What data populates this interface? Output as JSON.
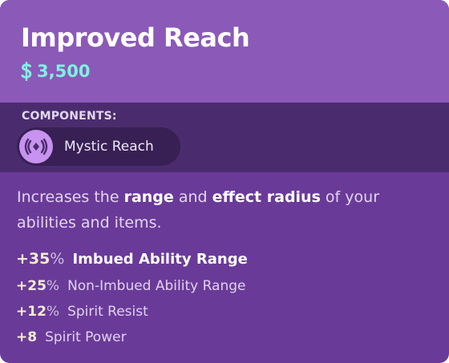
{
  "item": {
    "title": "Improved Reach",
    "price": "3,500"
  },
  "components": {
    "label": "COMPONENTS:",
    "items": [
      {
        "name": "Mystic Reach",
        "icon": "mystic-reach-icon"
      }
    ]
  },
  "description": {
    "part1": "Increases the ",
    "hl1": "range",
    "part2": " and ",
    "hl2": "effect radius",
    "part3": " of your abilities and items."
  },
  "stats": [
    {
      "value": "+35",
      "unit": "%",
      "label": "Imbued Ability Range"
    },
    {
      "value": "+25",
      "unit": "%",
      "label": "Non-Imbued Ability Range"
    },
    {
      "value": "+12",
      "unit": "%",
      "label": "Spirit Resist"
    },
    {
      "value": "+8",
      "unit": "",
      "label": "Spirit Power"
    }
  ],
  "colors": {
    "header": "#8b59b8",
    "body": "#6a3a99",
    "components_band": "#4a2c6e",
    "price": "#7ef2e0",
    "component_icon_bg": "#c792f0"
  }
}
